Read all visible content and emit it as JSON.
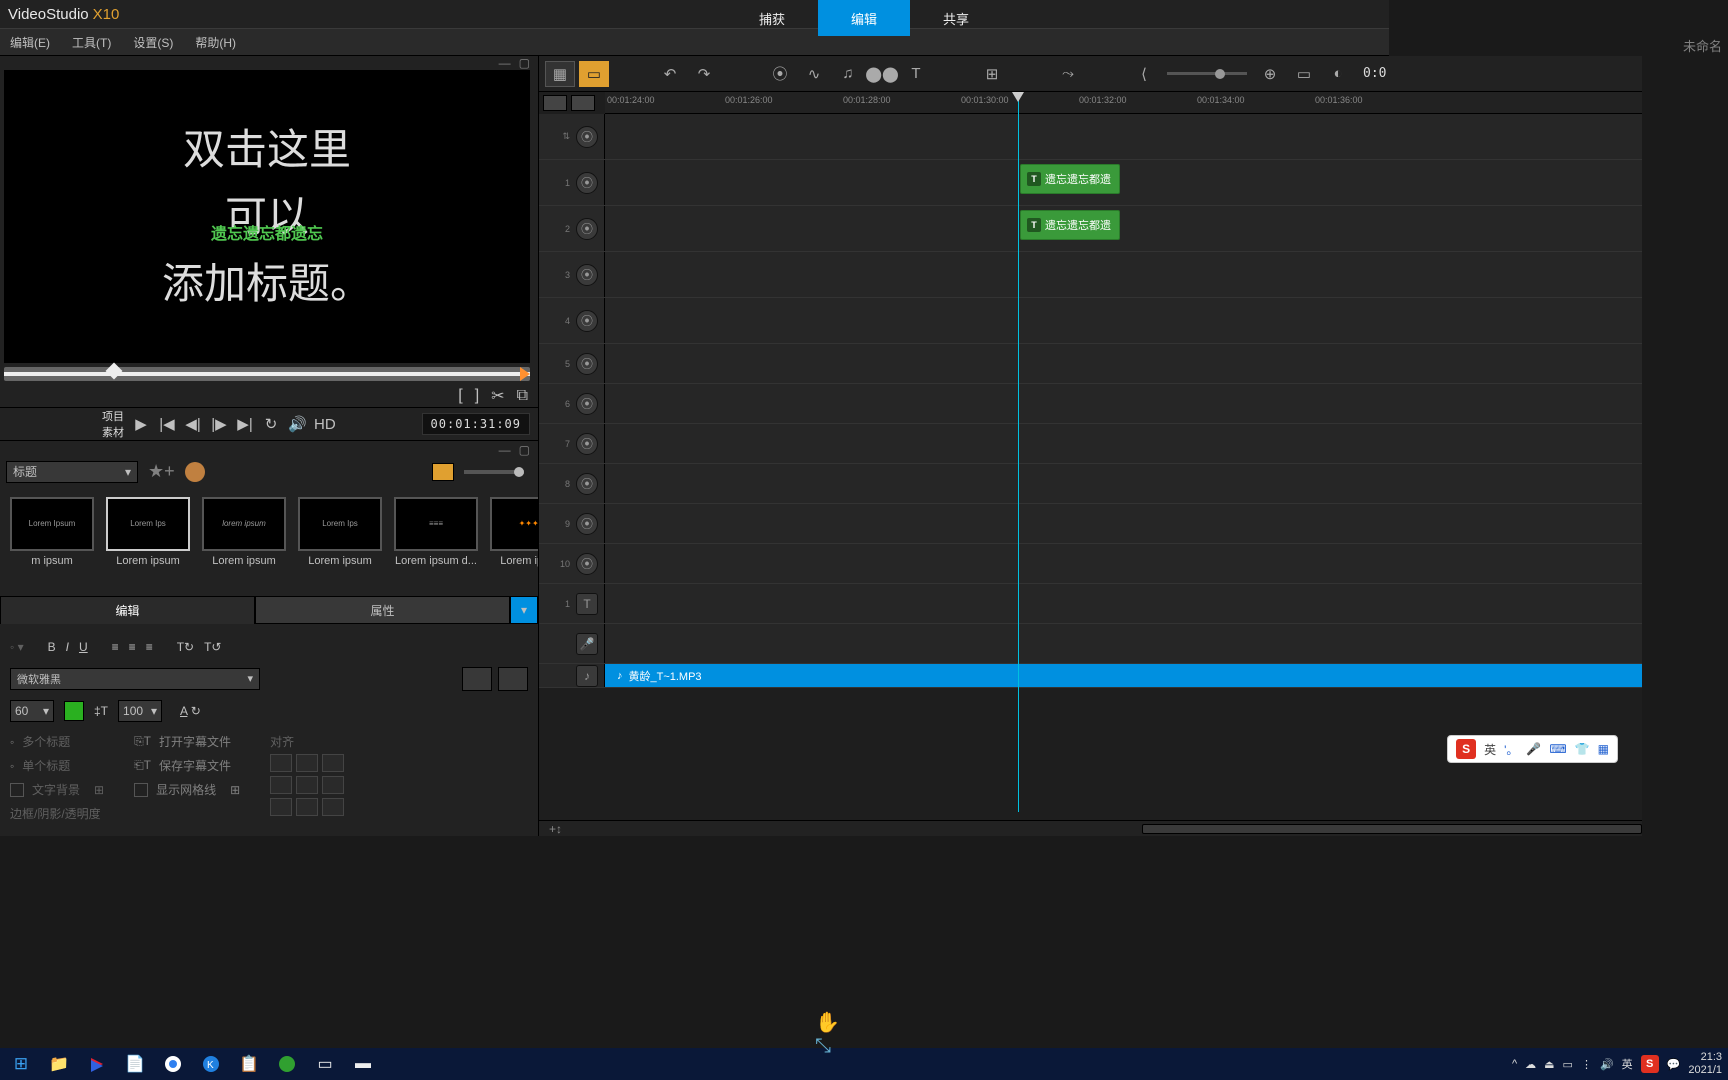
{
  "app": {
    "title": "VideoStudio",
    "suffix": "X10",
    "doc_status": "未命名"
  },
  "top_tabs": {
    "capture": "捕获",
    "edit": "编辑",
    "share": "共享"
  },
  "menubar": {
    "edit": "编辑(E)",
    "tools": "工具(T)",
    "settings": "设置(S)",
    "help": "帮助(H)"
  },
  "preview": {
    "line1": "双击这里",
    "line2": "可以",
    "line3": "添加标题。",
    "overlay": "遗忘遗忘都遗忘",
    "timecode": "00:01:31:09",
    "mode_project": "项目",
    "mode_clip": "素材",
    "hd": "HD"
  },
  "library": {
    "category": "标题",
    "thumbs": [
      {
        "label": "m ipsum"
      },
      {
        "label": "Lorem ipsum"
      },
      {
        "label": "Lorem ipsum"
      },
      {
        "label": "Lorem ipsum"
      },
      {
        "label": "Lorem ipsum d..."
      },
      {
        "label": "Lorem ipsum"
      }
    ]
  },
  "edit_tabs": {
    "edit": "编辑",
    "attr": "属性"
  },
  "font": {
    "family": "微软雅黑",
    "size": "60",
    "linespace": "100",
    "opt_multi": "多个标题",
    "opt_open": "打开字幕文件",
    "opt_single": "单个标题",
    "opt_save": "保存字幕文件",
    "opt_bg": "文字背景",
    "opt_grid": "显示网格线",
    "opt_dim": "边框/阴影/透明度",
    "opt_align": "对齐"
  },
  "timeline": {
    "ruler": [
      "00:01:24:00",
      "00:01:26:00",
      "00:01:28:00",
      "00:01:30:00",
      "00:01:32:00",
      "00:01:34:00",
      "00:01:36:00"
    ],
    "clip_text": "遗忘遗忘都遗",
    "clip_text2": "遗忘遗忘都遗",
    "audio_name": "黄龄_T~1.MP3",
    "counter": "0:0"
  },
  "ime": {
    "lang": "英",
    "dot": "'。"
  },
  "tray": {
    "lang": "英",
    "time": "21:3",
    "date": "2021/1"
  }
}
